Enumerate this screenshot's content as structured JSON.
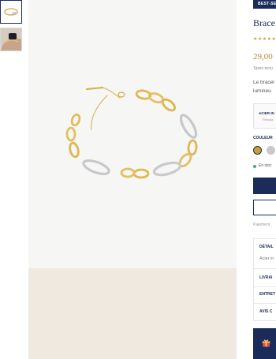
{
  "thumbnails": [
    {
      "name": "bracelet-thumbnail",
      "selected": true
    },
    {
      "name": "worn-bracelet-thumbnail",
      "selected": false
    }
  ],
  "product": {
    "badge": "BEST-SEL",
    "title": "Brace",
    "rating_stars": "★★★★★",
    "price": "29,00",
    "tax_note": "Taxes inclu",
    "description_line1": "Le bracel",
    "description_line2": "lumineu",
    "info_label": "ACIER IN",
    "info_sub": "Résista"
  },
  "color": {
    "label": "COULEUR",
    "options": [
      {
        "name": "gold",
        "hex": "#c6a232",
        "selected": true
      },
      {
        "name": "silver",
        "hex": "#c8c9cc",
        "selected": false
      }
    ]
  },
  "stock": {
    "text": "En stoc",
    "dot_color": "#3fb55d"
  },
  "payment_note": "Paiement",
  "accordion": {
    "details_label": "DÉTAIL",
    "details_sub": "Acier in",
    "delivery_label": "LIVRAI",
    "care_label": "ENTRET",
    "reviews_label": "AVIS C"
  },
  "colors": {
    "navy": "#1b2b5a",
    "gold_accent": "#b48a2f",
    "image_bg": "#f6f6f5",
    "secondary_image_bg": "#efe9df"
  }
}
